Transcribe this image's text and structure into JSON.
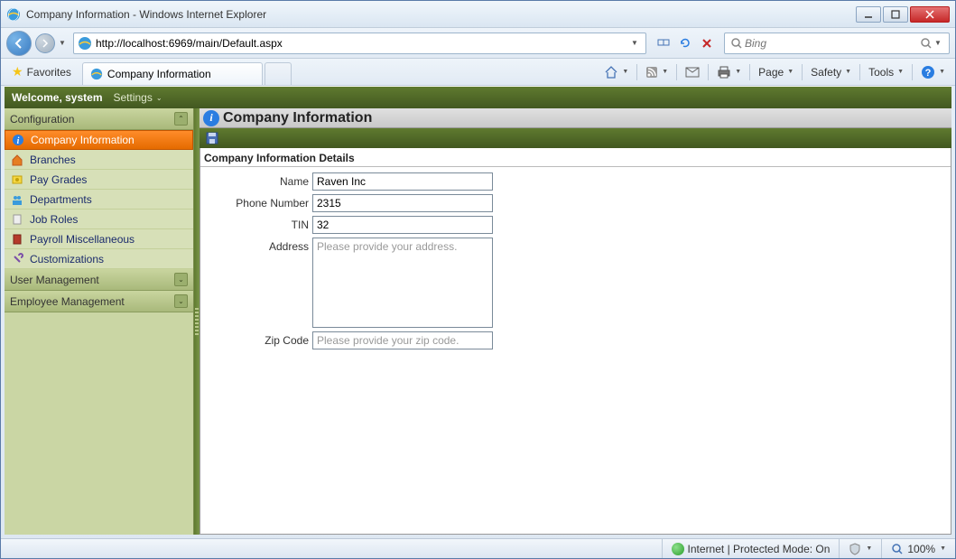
{
  "window": {
    "title": "Company Information - Windows Internet Explorer"
  },
  "address": {
    "url": "http://localhost:6969/main/Default.aspx"
  },
  "search": {
    "placeholder": "Bing"
  },
  "favorites": {
    "label": "Favorites"
  },
  "tab": {
    "label": "Company Information"
  },
  "cmdbar": {
    "page": "Page",
    "safety": "Safety",
    "tools": "Tools"
  },
  "app": {
    "welcome": "Welcome, system",
    "settings": "Settings"
  },
  "sidebar": {
    "sections": {
      "config": "Configuration",
      "usermgmt": "User Management",
      "empmgmt": "Employee Management"
    },
    "items": [
      {
        "label": "Company Information"
      },
      {
        "label": "Branches"
      },
      {
        "label": "Pay Grades"
      },
      {
        "label": "Departments"
      },
      {
        "label": "Job Roles"
      },
      {
        "label": "Payroll Miscellaneous"
      },
      {
        "label": "Customizations"
      }
    ]
  },
  "page_content": {
    "title": "Company Information",
    "section": "Company Information Details",
    "labels": {
      "name": "Name",
      "phone": "Phone Number",
      "tin": "TIN",
      "address": "Address",
      "zip": "Zip Code"
    },
    "values": {
      "name": "Raven Inc",
      "phone": "2315",
      "tin": "32",
      "address": "",
      "zip": ""
    },
    "placeholders": {
      "address": "Please provide your address.",
      "zip": "Please provide your zip code."
    }
  },
  "statusbar": {
    "zone": "Internet | Protected Mode: On",
    "zoom": "100%"
  }
}
